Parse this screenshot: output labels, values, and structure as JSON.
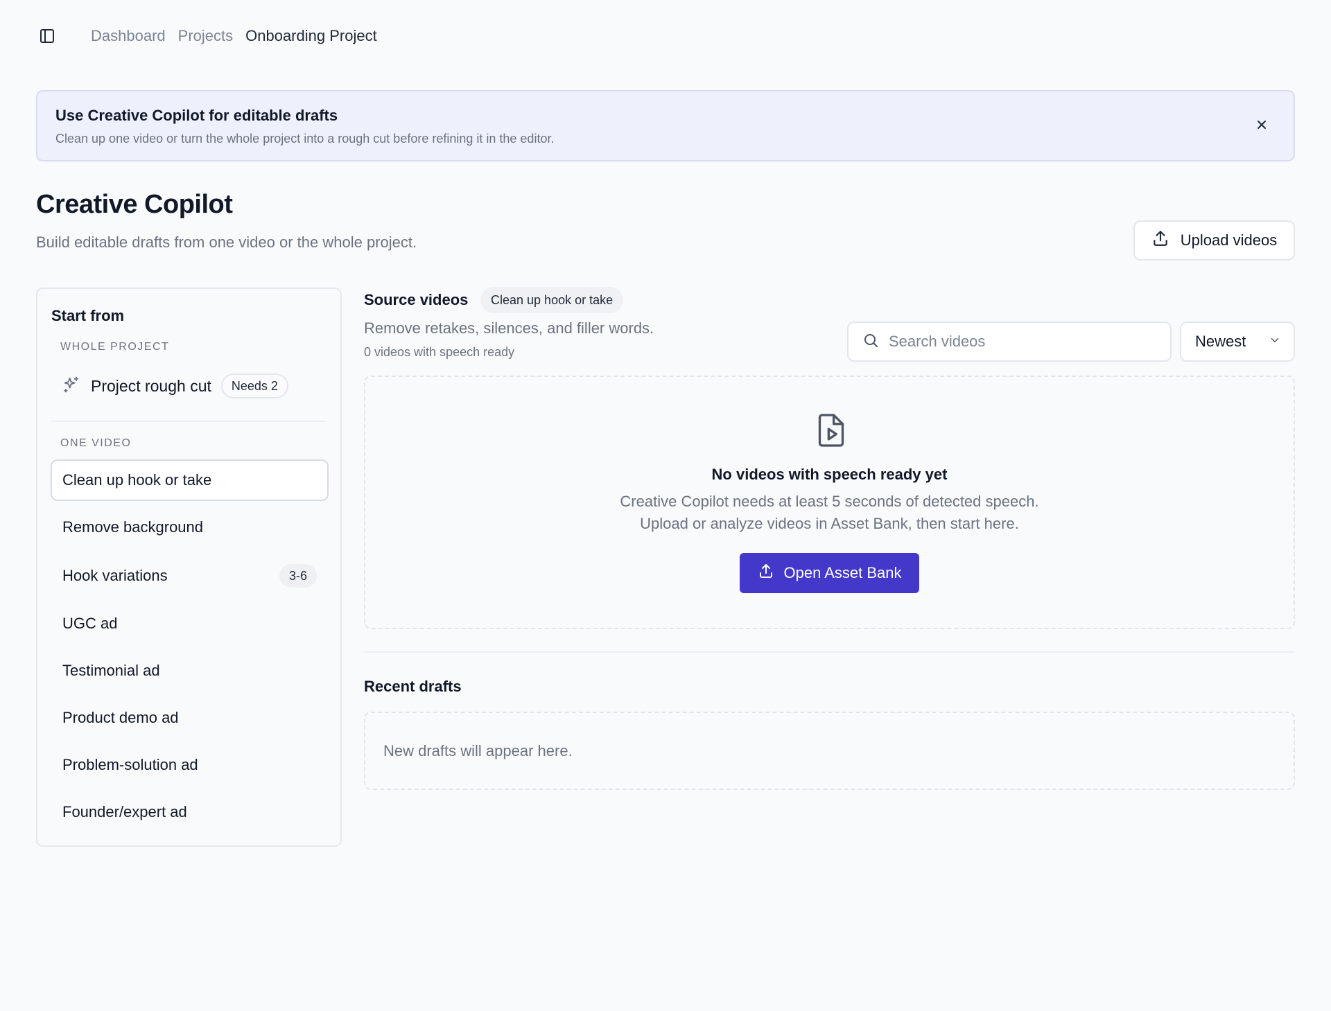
{
  "breadcrumb": [
    "Dashboard",
    "Projects",
    "Onboarding Project"
  ],
  "banner": {
    "title": "Use Creative Copilot for editable drafts",
    "text": "Clean up one video or turn the whole project into a rough cut before refining it in the editor."
  },
  "page": {
    "title": "Creative Copilot",
    "subtitle": "Build editable drafts from one video or the whole project.",
    "upload_label": "Upload videos"
  },
  "start_from": {
    "heading": "Start from",
    "whole_project_label": "WHOLE PROJECT",
    "rough_cut_label": "Project rough cut",
    "rough_cut_badge": "Needs 2",
    "one_video_label": "ONE VIDEO",
    "options": [
      {
        "label": "Clean up hook or take",
        "selected": true
      },
      {
        "label": "Remove background"
      },
      {
        "label": "Hook variations",
        "badge": "3-6"
      },
      {
        "label": "UGC ad"
      },
      {
        "label": "Testimonial ad"
      },
      {
        "label": "Product demo ad"
      },
      {
        "label": "Problem-solution ad"
      },
      {
        "label": "Founder/expert ad"
      }
    ]
  },
  "source": {
    "title": "Source videos",
    "chip": "Clean up hook or take",
    "description": "Remove retakes, silences, and filler words.",
    "count": "0 videos with speech ready",
    "search_placeholder": "Search videos",
    "sort": "Newest"
  },
  "empty_state": {
    "title": "No videos with speech ready yet",
    "line1": "Creative Copilot needs at least 5 seconds of detected speech.",
    "line2": "Upload or analyze videos in Asset Bank, then start here.",
    "button": "Open Asset Bank"
  },
  "recent": {
    "title": "Recent drafts",
    "empty": "New drafts will appear here."
  },
  "colors": {
    "accent": "#4338ca",
    "banner_bg": "#eef1fb",
    "page_bg": "#f9fafc"
  },
  "icons": {
    "sidebar_toggle": "sidebar-toggle-icon",
    "close": "close-icon",
    "upload": "upload-icon",
    "sparkles": "sparkles-icon",
    "search": "search-icon",
    "chevron": "chevron-down-icon",
    "file_video": "file-video-icon"
  }
}
